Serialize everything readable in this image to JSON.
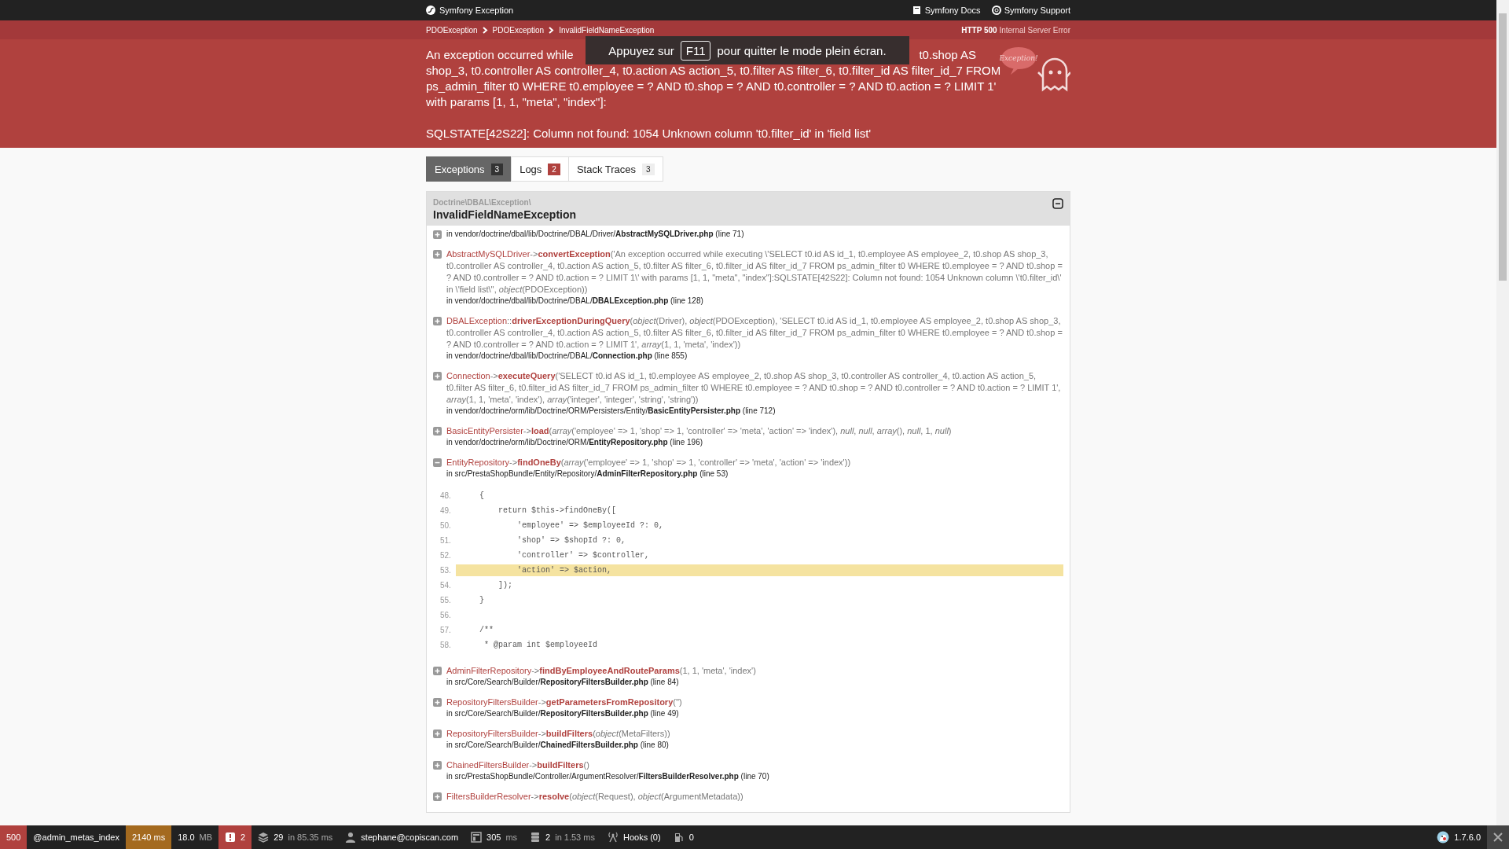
{
  "top_bar": {
    "title": "Symfony Exception",
    "links": [
      {
        "kind": "docs",
        "label": "Symfony Docs"
      },
      {
        "kind": "support",
        "label": "Symfony Support"
      }
    ]
  },
  "breadcrumbs": [
    "PDOException",
    "PDOException",
    "InvalidFieldNameException"
  ],
  "status": {
    "code": "HTTP 500",
    "text": "Internal Server Error"
  },
  "message_lines": [
    {
      "parts": [
        "An exception occurred while",
        "t0.shop AS"
      ]
    },
    {
      "parts": [
        "shop_3, t0.controller AS controller_4, t0.action AS action_5, t0.filter AS filter_6, t0.filter_id AS filter_id_7 FROM"
      ]
    },
    {
      "parts": [
        "ps_admin_filter t0 WHERE t0.employee = ? AND t0.shop = ? AND t0.controller = ? AND t0.action = ? LIMIT 1'"
      ]
    },
    {
      "parts": [
        "with params [1, 1, \"meta\", \"index\"]:"
      ]
    }
  ],
  "sql_error": "SQLSTATE[42S22]: Column not found: 1054 Unknown column 't0.filter_id' in 'field list'",
  "mascot_label": "Exception!",
  "fullscreen_notice": {
    "before": "Appuyez sur",
    "key": "F11",
    "after": "pour quitter le mode plein écran."
  },
  "tabs": [
    {
      "label": "Exceptions",
      "count": "3",
      "kind": "default",
      "selected": true
    },
    {
      "label": "Logs",
      "count": "2",
      "kind": "error",
      "selected": false
    },
    {
      "label": "Stack Traces",
      "count": "3",
      "kind": "default",
      "selected": false
    }
  ],
  "exception": {
    "namespace": "Doctrine\\DBAL\\Exception\\",
    "name": "InvalidFieldNameException",
    "expanded": true
  },
  "traces": [
    {
      "expanded": false,
      "location": "in vendor/doctrine/dbal/lib/Doctrine/DBAL/Driver/**AbstractMySQLDriver.php** (line 71)"
    },
    {
      "expanded": false,
      "class": "AbstractMySQLDriver",
      "operator": "->",
      "method": "convertException",
      "args": "('An exception occurred while executing \\'SELECT t0.id AS id_1, t0.employee AS employee_2, t0.shop AS shop_3, t0.controller AS controller_4, t0.action AS action_5, t0.filter AS filter_6, t0.filter_id AS filter_id_7 FROM ps_admin_filter t0 WHERE t0.employee = ? AND t0.shop = ? AND t0.controller = ? AND t0.action = ? LIMIT 1\\' with params [1, 1, \"meta\", \"index\"]:SQLSTATE[42S22]: Column not found: 1054 Unknown column \\'t0.filter_id\\' in \\'field list\\'', *object*(PDOException))",
      "location": "in vendor/doctrine/dbal/lib/Doctrine/DBAL/**DBALException.php** (line 128)"
    },
    {
      "expanded": false,
      "class": "DBALException",
      "operator": "::",
      "method": "driverExceptionDuringQuery",
      "args": "(*object*(Driver), *object*(PDOException), 'SELECT t0.id AS id_1, t0.employee AS employee_2, t0.shop AS shop_3, t0.controller AS controller_4, t0.action AS action_5, t0.filter AS filter_6, t0.filter_id AS filter_id_7 FROM ps_admin_filter t0 WHERE t0.employee = ? AND t0.shop = ? AND t0.controller = ? AND t0.action = ? LIMIT 1', *array*(1, 1, 'meta', 'index'))",
      "location": "in vendor/doctrine/dbal/lib/Doctrine/DBAL/**Connection.php** (line 855)"
    },
    {
      "expanded": false,
      "class": "Connection",
      "operator": "->",
      "method": "executeQuery",
      "args": "('SELECT t0.id AS id_1, t0.employee AS employee_2, t0.shop AS shop_3, t0.controller AS controller_4, t0.action AS action_5, t0.filter AS filter_6, t0.filter_id AS filter_id_7 FROM ps_admin_filter t0 WHERE t0.employee = ? AND t0.shop = ? AND t0.controller = ? AND t0.action = ? LIMIT 1', *array*(1, 1, 'meta', 'index'), *array*('integer', 'integer', 'string', 'string'))",
      "location": "in vendor/doctrine/orm/lib/Doctrine/ORM/Persisters/Entity/**BasicEntityPersister.php** (line 712)"
    },
    {
      "expanded": false,
      "class": "BasicEntityPersister",
      "operator": "->",
      "method": "load",
      "args": "(*array*('employee' => 1, 'shop' => 1, 'controller' => 'meta', 'action' => 'index'), *null*, *null*, *array*(), *null*, 1, *null*)",
      "location": "in vendor/doctrine/orm/lib/Doctrine/ORM/**EntityRepository.php** (line 196)"
    },
    {
      "expanded": true,
      "class": "EntityRepository",
      "operator": "->",
      "method": "findOneBy",
      "args": "(*array*('employee' => 1, 'shop' => 1, 'controller' => 'meta', 'action' => 'index'))",
      "location": "in src/PrestaShopBundle/Entity/Repository/**AdminFilterRepository.php** (line 53)",
      "code": [
        {
          "number": "48.",
          "text": "    {",
          "highlighted": false
        },
        {
          "number": "49.",
          "text": "        return $this->findOneBy([",
          "highlighted": false
        },
        {
          "number": "50.",
          "text": "            'employee' => $employeeId ?: 0,",
          "highlighted": false
        },
        {
          "number": "51.",
          "text": "            'shop' => $shopId ?: 0,",
          "highlighted": false
        },
        {
          "number": "52.",
          "text": "            'controller' => $controller,",
          "highlighted": false
        },
        {
          "number": "53.",
          "text": "            'action' => $action,",
          "highlighted": true
        },
        {
          "number": "54.",
          "text": "        ]);",
          "highlighted": false
        },
        {
          "number": "55.",
          "text": "    }",
          "highlighted": false
        },
        {
          "number": "56.",
          "highlighted": false
        },
        {
          "number": "57.",
          "text": "    /**",
          "highlighted": false
        },
        {
          "number": "58.",
          "text": "     * @param int $employeeId",
          "highlighted": false
        }
      ]
    },
    {
      "expanded": false,
      "class": "AdminFilterRepository",
      "operator": "->",
      "method": "findByEmployeeAndRouteParams",
      "args": "(1, 1, 'meta', 'index')",
      "location": "in src/Core/Search/Builder/**RepositoryFiltersBuilder.php** (line 84)"
    },
    {
      "expanded": false,
      "class": "RepositoryFiltersBuilder",
      "operator": "->",
      "method": "getParametersFromRepository",
      "args": "('')",
      "location": "in src/Core/Search/Builder/**RepositoryFiltersBuilder.php** (line 49)"
    },
    {
      "expanded": false,
      "class": "RepositoryFiltersBuilder",
      "operator": "->",
      "method": "buildFilters",
      "args": "(*object*(MetaFilters))",
      "location": "in src/Core/Search/Builder/**ChainedFiltersBuilder.php** (line 80)"
    },
    {
      "expanded": false,
      "class": "ChainedFiltersBuilder",
      "operator": "->",
      "method": "buildFilters",
      "args": "()",
      "location": "in src/PrestaShopBundle/Controller/ArgumentResolver/**FiltersBuilderResolver.php** (line 70)"
    },
    {
      "expanded": false,
      "class": "FiltersBuilderResolver",
      "operator": "->",
      "method": "resolve",
      "args": "(*object*(Request), *object*(ArgumentMetadata))"
    }
  ],
  "toolbar": {
    "items": [
      {
        "kind": "plain",
        "value": "500",
        "color": "#b0413e"
      },
      {
        "kind": "plain",
        "value": "@admin_metas_index",
        "color": "#222222"
      },
      {
        "kind": "plain",
        "value": "2140 ms",
        "color": "#a46a1f"
      },
      {
        "kind": "plain",
        "value": "18.0",
        "detail": "MB",
        "color": "#222222"
      },
      {
        "kind": "alert",
        "value": "2",
        "color": "#b0413e"
      },
      {
        "kind": "layers",
        "value": "29",
        "detail": "in 85.35 ms",
        "color": "#222222"
      },
      {
        "kind": "user",
        "value": "stephane@copiscan.com",
        "color": "#222222"
      },
      {
        "kind": "template",
        "value": "305",
        "detail": "ms",
        "color": "#222222"
      },
      {
        "kind": "database",
        "value": "2",
        "detail": "in 1.53 ms",
        "color": "#222222"
      },
      {
        "kind": "hooks",
        "value": "Hooks (0)",
        "color": "#222222"
      },
      {
        "kind": "pump",
        "value": "0",
        "color": "#222222"
      }
    ],
    "version": "1.7.6.0"
  }
}
